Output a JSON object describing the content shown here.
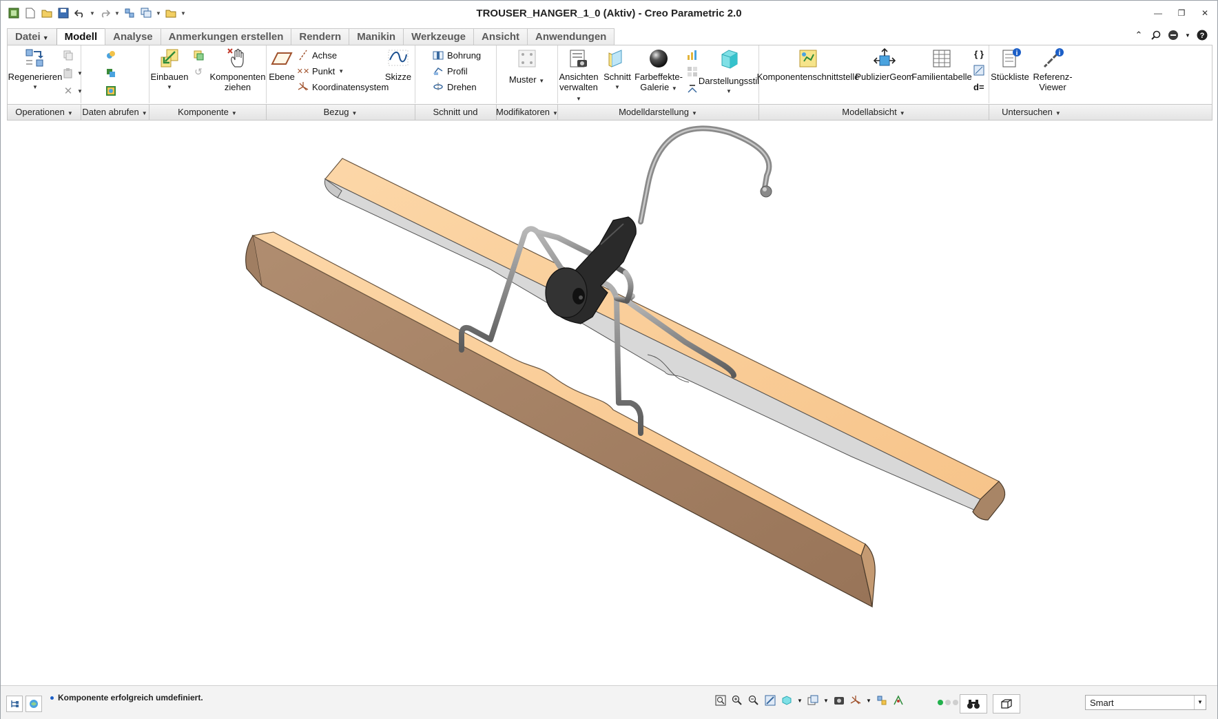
{
  "window": {
    "title": "TROUSER_HANGER_1_0 (Aktiv) - Creo Parametric 2.0"
  },
  "tabs": [
    {
      "label": "Datei",
      "has_dropdown": true
    },
    {
      "label": "Modell",
      "active": true
    },
    {
      "label": "Analyse"
    },
    {
      "label": "Anmerkungen erstellen"
    },
    {
      "label": "Rendern"
    },
    {
      "label": "Manikin"
    },
    {
      "label": "Werkzeuge"
    },
    {
      "label": "Ansicht"
    },
    {
      "label": "Anwendungen"
    }
  ],
  "ribbon": {
    "regenerieren": "Regenerieren",
    "einbauen": "Einbauen",
    "komponenten_ziehen_1": "Komponenten",
    "komponenten_ziehen_2": "ziehen",
    "ebene": "Ebene",
    "achse": "Achse",
    "punkt": "Punkt",
    "koordinatensystem": "Koordinatensystem",
    "skizze": "Skizze",
    "bohrung": "Bohrung",
    "profil": "Profil",
    "drehen": "Drehen",
    "muster": "Muster",
    "ansichten_1": "Ansichten",
    "ansichten_2": "verwalten",
    "schnitt": "Schnitt",
    "farbeffekte_1": "Farbeffekte-",
    "farbeffekte_2": "Galerie",
    "darstellungsstil": "Darstellungsstil",
    "komponentenschnittstelle": "Komponentenschnittstelle",
    "publiziergeom": "PublizierGeom",
    "familientabelle": "Familientabelle",
    "dgleich": "d=",
    "stueckliste": "Stückliste",
    "referenz_1": "Referenz-",
    "referenz_2": "Viewer"
  },
  "groups": [
    {
      "label": "Operationen"
    },
    {
      "label": "Daten abrufen"
    },
    {
      "label": "Komponente"
    },
    {
      "label": "Bezug"
    },
    {
      "label": "Schnitt und Fläche"
    },
    {
      "label": "Modifikatoren"
    },
    {
      "label": "Modelldarstellung"
    },
    {
      "label": "Modellabsicht"
    },
    {
      "label": "Untersuchen"
    }
  ],
  "status": {
    "message": "Komponente erfolgreich umdefiniert.",
    "filter_value": "Smart"
  },
  "colors": {
    "wood_top": "#fcd5a4",
    "wood_side": "#a8856a",
    "wood_end": "#c49a72",
    "metal": "#8c8c8c",
    "rubber": "#2a2a2a",
    "accent": "#1c5fc7"
  }
}
